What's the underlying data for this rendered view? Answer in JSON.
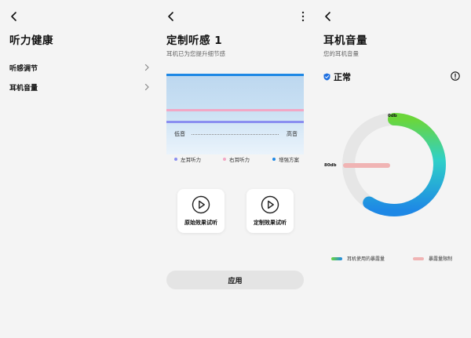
{
  "panel1": {
    "title": "听力健康",
    "items": [
      {
        "label": "听感调节"
      },
      {
        "label": "耳机音量"
      }
    ]
  },
  "panel2": {
    "title": "定制听感 1",
    "subtitle": "耳机已为您提升细节感",
    "freq_low": "低音",
    "freq_high": "高音",
    "legend": [
      {
        "label": "左耳听力",
        "color": "#8b8ff0"
      },
      {
        "label": "右耳听力",
        "color": "#f2a7c5"
      },
      {
        "label": "增强方案",
        "color": "#1e88e5"
      }
    ],
    "buttons": {
      "original": "原始效果试听",
      "custom": "定制效果试听"
    },
    "apply": "应用"
  },
  "panel3": {
    "title": "耳机音量",
    "subtitle": "您的耳机音量",
    "status": "正常",
    "gauge": {
      "top_label": "0db",
      "left_label": "80db",
      "usage_color_start": "#6bd63a",
      "usage_color_end": "#1e88e5",
      "limit_color": "#f0b4b4",
      "track_color": "#e6e6e6"
    },
    "legend": [
      {
        "label": "耳机使用的暴露量"
      },
      {
        "label": "暴露量限制"
      }
    ]
  }
}
